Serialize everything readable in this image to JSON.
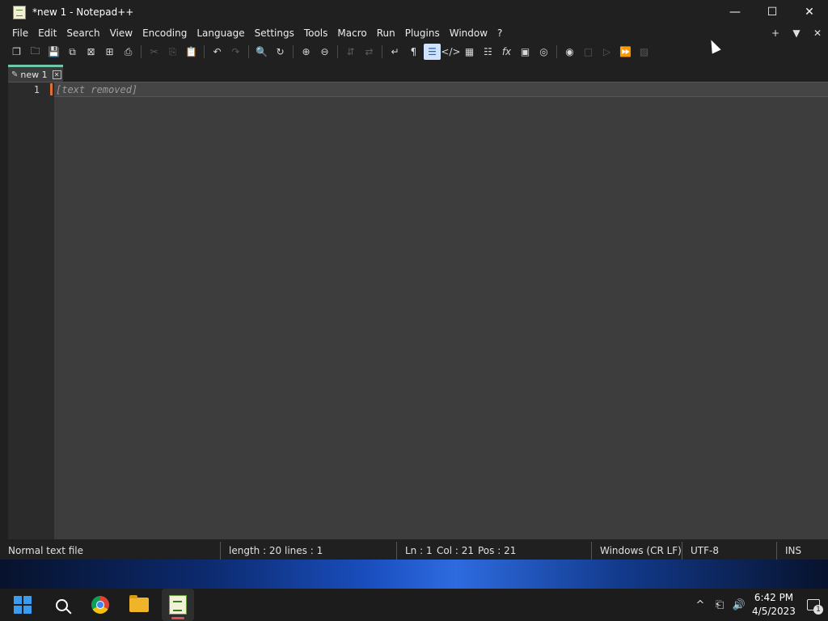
{
  "window": {
    "title": "*new 1 - Notepad++",
    "minimize_glyph": "—",
    "maximize_glyph": "☐",
    "close_glyph": "✕"
  },
  "menu": {
    "items": [
      "File",
      "Edit",
      "Search",
      "View",
      "Encoding",
      "Language",
      "Settings",
      "Tools",
      "Macro",
      "Run",
      "Plugins",
      "Window",
      "?"
    ],
    "right": [
      "+",
      "▼",
      "✕"
    ]
  },
  "toolbar": {
    "icons": [
      "new-file-icon",
      "open-file-icon",
      "save-icon",
      "save-all-icon",
      "close-icon",
      "close-all-icon",
      "print-icon",
      "cut-icon",
      "copy-icon",
      "paste-icon",
      "undo-icon",
      "redo-icon",
      "find-icon",
      "replace-icon",
      "zoom-in-icon",
      "zoom-out-icon",
      "sync-vertical-icon",
      "sync-horizontal-icon",
      "word-wrap-icon",
      "show-all-characters-icon",
      "indent-guide-icon",
      "xml-tag-icon",
      "document-map-icon",
      "document-list-icon",
      "function-list-icon",
      "folder-as-workspace-icon",
      "monitoring-icon",
      "record-macro-icon",
      "stop-recording-icon",
      "playback-macro-icon",
      "run-macro-multiple-icon",
      "save-macro-icon"
    ]
  },
  "tabs": [
    {
      "label": "new 1",
      "close_glyph": "✕"
    }
  ],
  "editor": {
    "line_numbers": [
      "1"
    ],
    "lines": [
      "[text removed]"
    ]
  },
  "status": {
    "file_type": "Normal text file",
    "length": "length : 20",
    "lines": "lines : 1",
    "ln": "Ln : 1",
    "col": "Col : 21",
    "pos": "Pos : 21",
    "eol": "Windows (CR LF)",
    "encoding": "UTF-8",
    "mode": "INS"
  },
  "taskbar": {
    "apps": [
      "start-icon",
      "search-icon",
      "chrome-icon",
      "file-explorer-icon",
      "notepad-plus-plus-icon"
    ],
    "tray": {
      "chevron": "^",
      "network": "⎗",
      "volume": "🔊",
      "time": "6:42 PM",
      "date": "4/5/2023",
      "notification_count": "1"
    }
  },
  "colors": {
    "window_bg": "#202020",
    "editor_bg": "#3d3d3d",
    "tab_accent": "#6fc8a8",
    "caret_mark": "#e07030",
    "active_tool": "#cfe3ff"
  }
}
